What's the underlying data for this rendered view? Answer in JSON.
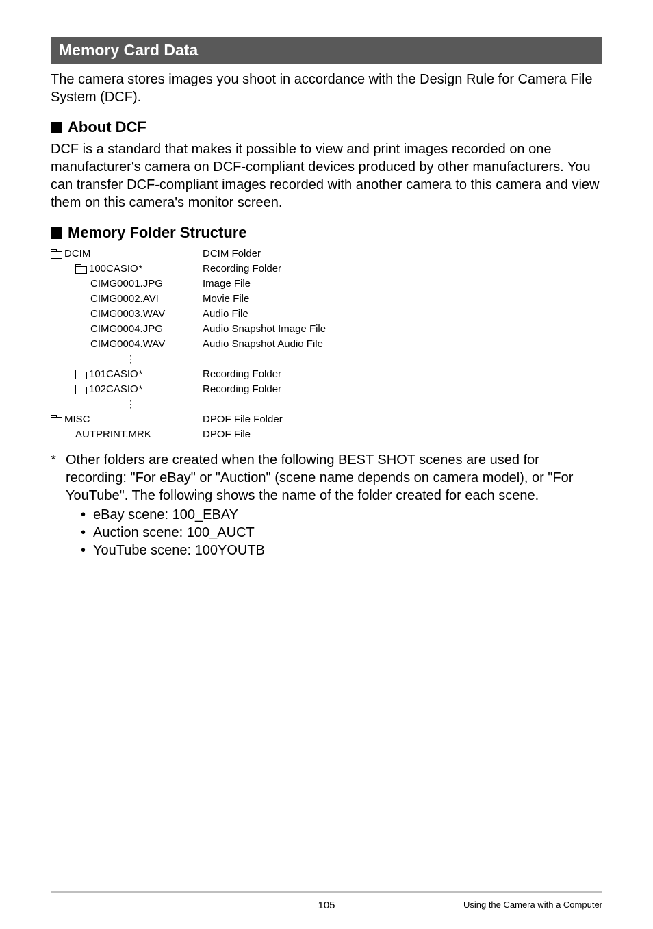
{
  "section_title": "Memory Card Data",
  "intro": "The camera stores images you shoot in accordance with the Design Rule for Camera File System (DCF).",
  "sub1_title": "About DCF",
  "sub1_body": "DCF is a standard that makes it possible to view and print images recorded on one manufacturer's camera on DCF-compliant devices produced by other manufacturers. You can transfer DCF-compliant images recorded with another camera to this camera and view them on this camera's monitor screen.",
  "sub2_title": "Memory Folder Structure",
  "tree": {
    "dcim": "DCIM",
    "f100": "100CASIO",
    "file1": "CIMG0001.JPG",
    "file2": "CIMG0002.AVI",
    "file3": "CIMG0003.WAV",
    "file4": "CIMG0004.JPG",
    "file5": "CIMG0004.WAV",
    "f101": "101CASIO",
    "f102": "102CASIO",
    "misc": "MISC",
    "autprint": "AUTPRINT.MRK"
  },
  "desc": {
    "dcim": "DCIM Folder",
    "f100": "Recording Folder",
    "file1": "Image File",
    "file2": "Movie File",
    "file3": "Audio File",
    "file4": "Audio Snapshot Image File",
    "file5": "Audio Snapshot Audio File",
    "f101": "Recording Folder",
    "f102": "Recording Folder",
    "misc": "DPOF File Folder",
    "autprint": "DPOF File"
  },
  "footnote_star": "*",
  "footnote_text": "Other folders are created when the following BEST SHOT scenes are used for recording: \"For eBay\" or \"Auction\" (scene name depends on camera model), or \"For YouTube\". The following shows the name of the folder created for each scene.",
  "bullets": [
    "eBay scene: 100_EBAY",
    "Auction scene: 100_AUCT",
    "YouTube scene: 100YOUTB"
  ],
  "footer_text": "Using the Camera with a Computer",
  "page_number": "105"
}
